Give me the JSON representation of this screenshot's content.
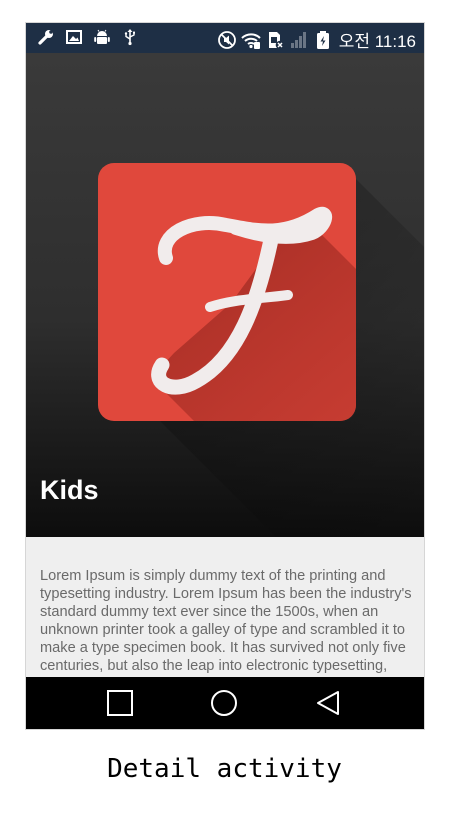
{
  "status_bar": {
    "left_icons": [
      "wrench-icon",
      "image-icon",
      "android-icon",
      "usb-icon"
    ],
    "right_icons": [
      "mute-icon",
      "wifi-icon",
      "no-sim-icon",
      "signal-icon",
      "battery-icon"
    ],
    "time": "오전 11:16"
  },
  "detail": {
    "title": "Kids",
    "body": "Lorem Ipsum is simply dummy text of the printing and typesetting industry. Lorem Ipsum has been the industry's standard dummy text ever since the 1500s, when an unknown printer took a galley of type and scrambled it to make a type specimen book. It has survived not only five centuries, but also the leap into electronic typesetting, remaining essentially unchanged."
  },
  "app_icon": {
    "letter": "F",
    "color": "#e0483c"
  },
  "nav_bar": {
    "buttons": [
      "recents-icon",
      "home-icon",
      "back-icon"
    ]
  },
  "caption": "Detail activity"
}
